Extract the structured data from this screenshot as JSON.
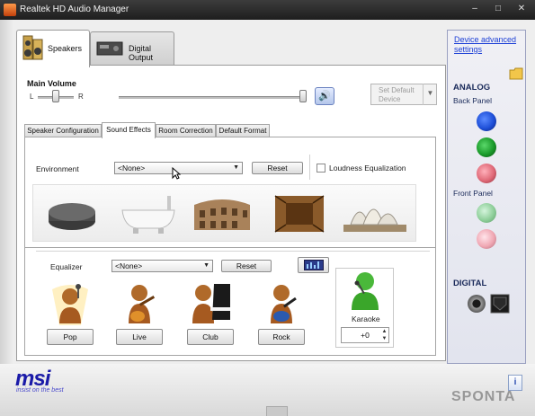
{
  "window": {
    "title": "Realtek HD Audio Manager",
    "controls": {
      "minimize": "–",
      "maximize": "□",
      "close": "✕"
    }
  },
  "device_tabs": [
    {
      "label": "Speakers",
      "active": true,
      "icon": "speaker-icon"
    },
    {
      "label": "Digital Output",
      "active": false,
      "icon": "digital-output-device-icon"
    }
  ],
  "main_volume": {
    "label": "Main Volume",
    "left_label": "L",
    "right_label": "R",
    "balance": 0.5,
    "volume": 1.0,
    "mute_icon": "speaker-volume-icon",
    "set_default_label": "Set Default Device"
  },
  "sub_tabs": [
    {
      "label": "Speaker Configuration",
      "active": false
    },
    {
      "label": "Sound Effects",
      "active": true
    },
    {
      "label": "Room Correction",
      "active": false
    },
    {
      "label": "Default Format",
      "active": false
    }
  ],
  "environment": {
    "label": "Environment",
    "selected": "<None>",
    "reset_label": "Reset",
    "loudness_label": "Loudness Equalization",
    "loudness_checked": false,
    "presets": [
      "stone-disc-icon",
      "bathtub-icon",
      "colosseum-icon",
      "wooden-room-icon",
      "opera-house-icon"
    ]
  },
  "equalizer": {
    "label": "Equalizer",
    "selected": "<None>",
    "reset_label": "Reset",
    "graphic_eq_icon": "graphic-equalizer-icon",
    "presets": [
      {
        "label": "Pop",
        "icon": "pop-singer-icon"
      },
      {
        "label": "Live",
        "icon": "guitar-player-icon"
      },
      {
        "label": "Club",
        "icon": "piano-player-icon"
      },
      {
        "label": "Rock",
        "icon": "rock-guitarist-icon"
      }
    ],
    "karaoke": {
      "label": "Karaoke",
      "value": "+0",
      "icon": "karaoke-singer-icon"
    }
  },
  "side_panel": {
    "link_label": "Device advanced settings",
    "analog_label": "ANALOG",
    "back_panel_label": "Back Panel",
    "front_panel_label": "Front Panel",
    "digital_label": "DIGITAL",
    "back_jacks": [
      "#1e4fd8",
      "#1a9a2a",
      "#e06a78"
    ],
    "front_jacks": [
      "#8fcf9a",
      "#f0a8b4"
    ]
  },
  "brand": {
    "logo": "msi",
    "tagline": "insist on the best",
    "watermark": "SPONTA"
  },
  "colors": {
    "title_bar": "#2a2a2a",
    "link": "#1c3fd6",
    "brand_blue": "#1a1aa8"
  }
}
